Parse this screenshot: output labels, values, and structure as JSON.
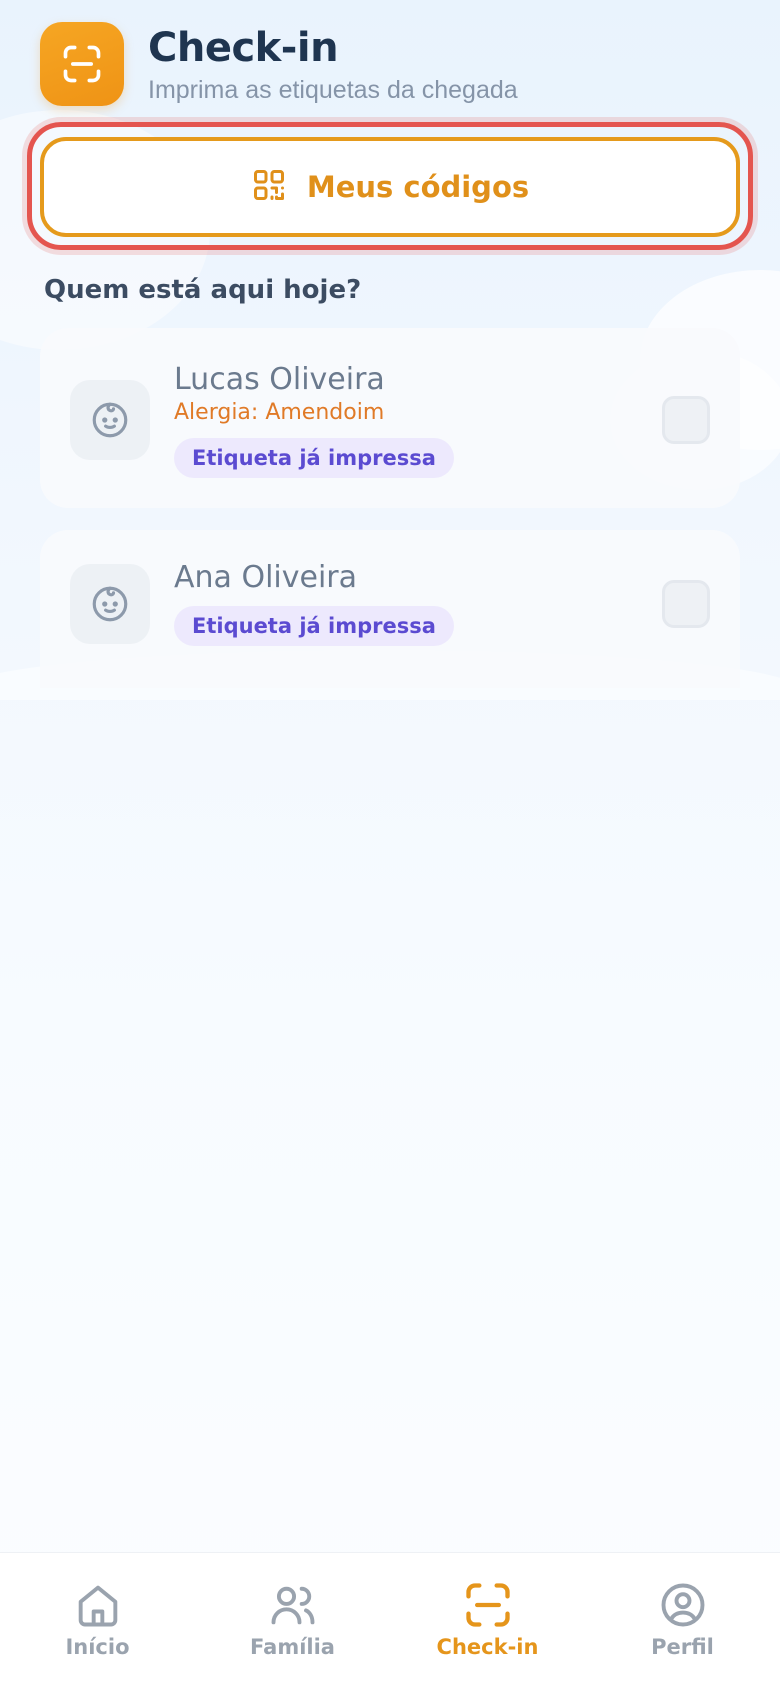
{
  "header": {
    "title": "Check-in",
    "subtitle": "Imprima as etiquetas da chegada",
    "icon": "scan-icon"
  },
  "codes_button": {
    "label": "Meus códigos",
    "icon": "qr-code-icon"
  },
  "section_title": "Quem está aqui hoje?",
  "children": [
    {
      "name": "Lucas Oliveira",
      "allergy": "Alergia: Amendoim",
      "badge": "Etiqueta já impressa",
      "checked": false
    },
    {
      "name": "Ana Oliveira",
      "badge": "Etiqueta já impressa",
      "checked": false
    }
  ],
  "nav": {
    "items": [
      {
        "label": "Início",
        "icon": "home-icon",
        "active": false
      },
      {
        "label": "Família",
        "icon": "users-icon",
        "active": false
      },
      {
        "label": "Check-in",
        "icon": "scan-icon",
        "active": true
      },
      {
        "label": "Perfil",
        "icon": "user-circle-icon",
        "active": false
      }
    ]
  },
  "colors": {
    "accent": "#E5951B",
    "highlight": "#E4554F",
    "allergy": "#E07A27",
    "badge_text": "#5B4BD1",
    "badge_bg": "#EDE9FD",
    "title": "#1F3550"
  }
}
